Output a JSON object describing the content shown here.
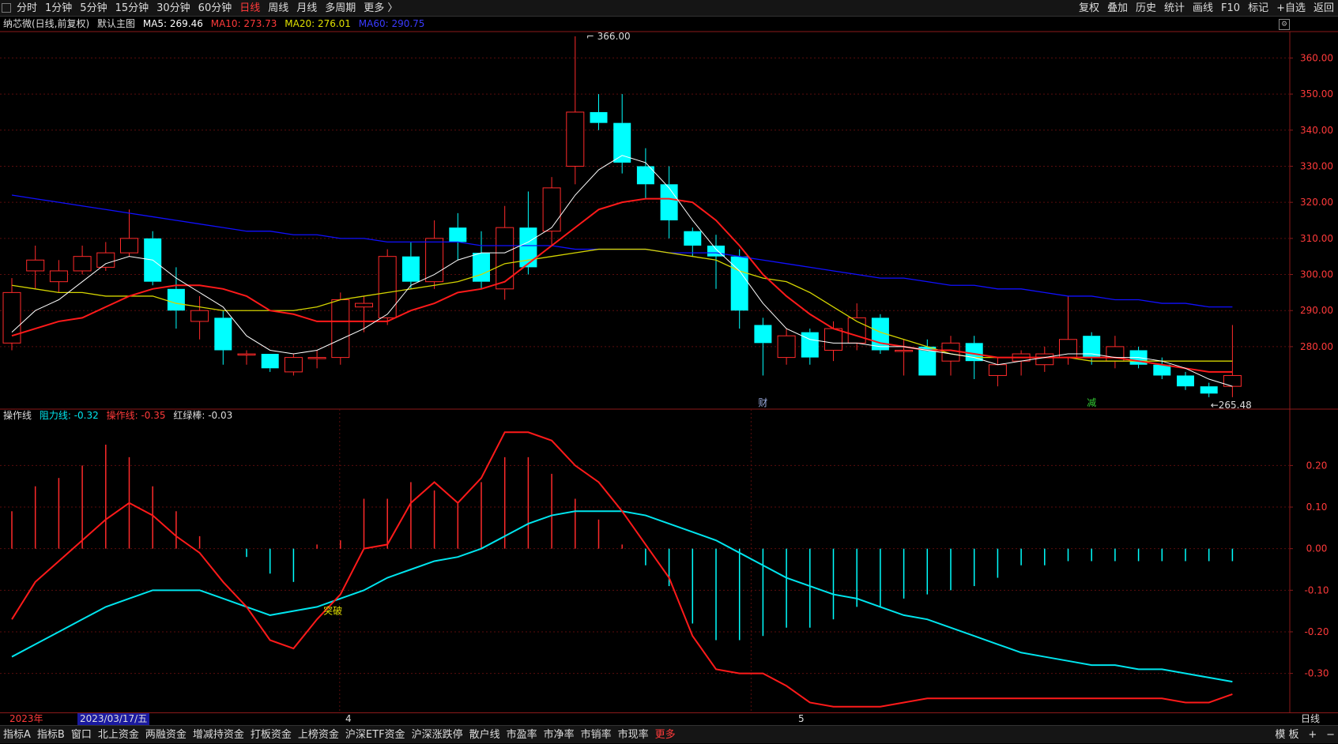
{
  "toolbar": {
    "left": [
      "分时",
      "1分钟",
      "5分钟",
      "15分钟",
      "30分钟",
      "60分钟",
      "日线",
      "周线",
      "月线",
      "多周期",
      "更多 〉"
    ],
    "active_index": 6,
    "right": [
      "复权",
      "叠加",
      "历史",
      "统计",
      "画线",
      "F10",
      "标记",
      "+自选",
      "返回"
    ]
  },
  "main_panel": {
    "title": "纳芯微(日线,前复权)",
    "template": "默认主图",
    "ma5": "MA5: 269.46",
    "ma10": "MA10: 273.73",
    "ma20": "MA20: 276.01",
    "ma60": "MA60: 290.75"
  },
  "sub_panel": {
    "title": "操作线",
    "resistance": "阻力线: -0.32",
    "operation": "操作线: -0.35",
    "bar": "红绿棒: -0.03"
  },
  "colors": {
    "up": "#ff2a2a",
    "down": "#00ffff",
    "ma5": "#ffffff",
    "ma10": "#ff1a1a",
    "ma20": "#d4d400",
    "ma60": "#1010ff",
    "resistance": "#00e5ee",
    "operation": "#ff1a1a"
  },
  "chart_data": [
    {
      "type": "candlestick",
      "name": "price",
      "ylim": [
        264,
        366
      ],
      "yticks": [
        280,
        290,
        300,
        310,
        320,
        330,
        340,
        350,
        360
      ],
      "ytick_labels": [
        "280.00",
        "290.00",
        "300.00",
        "310.00",
        "320.00",
        "330.00",
        "340.00",
        "350.00",
        "360.00"
      ],
      "annotations": {
        "high": "366.00",
        "low": "265.48",
        "events": [
          "财",
          "减"
        ]
      },
      "candles": [
        [
          281,
          295,
          279,
          299
        ],
        [
          301,
          304,
          296,
          308
        ],
        [
          298,
          301,
          295,
          304
        ],
        [
          301,
          305,
          300,
          308
        ],
        [
          302,
          306,
          301,
          309
        ],
        [
          306,
          310,
          305,
          318
        ],
        [
          310,
          298,
          297,
          312
        ],
        [
          296,
          290,
          285,
          302
        ],
        [
          287,
          290,
          282,
          294
        ],
        [
          288,
          279,
          275,
          290
        ],
        [
          278,
          278,
          275,
          279
        ],
        [
          278,
          274,
          273,
          278
        ],
        [
          273,
          277,
          272,
          278
        ],
        [
          277,
          277,
          274,
          279
        ],
        [
          277,
          293,
          275,
          295
        ],
        [
          291,
          292,
          284,
          294
        ],
        [
          288,
          305,
          286,
          307
        ],
        [
          305,
          298,
          296,
          309
        ],
        [
          298,
          310,
          296,
          315
        ],
        [
          313,
          309,
          304,
          317
        ],
        [
          306,
          298,
          296,
          312
        ],
        [
          296,
          313,
          293,
          319
        ],
        [
          313,
          302,
          300,
          323
        ],
        [
          312,
          324,
          308,
          327
        ],
        [
          330,
          345,
          325,
          366
        ],
        [
          345,
          342,
          340,
          350
        ],
        [
          342,
          331,
          328,
          350
        ],
        [
          330,
          325,
          321,
          335
        ],
        [
          325,
          315,
          310,
          330
        ],
        [
          312,
          308,
          305,
          313
        ],
        [
          308,
          305,
          296,
          311
        ],
        [
          305,
          290,
          285,
          307
        ],
        [
          286,
          281,
          272,
          288
        ],
        [
          277,
          283,
          275,
          285
        ],
        [
          284,
          277,
          275,
          285
        ],
        [
          279,
          285,
          276,
          287
        ],
        [
          281,
          288,
          279,
          292
        ],
        [
          288,
          279,
          278,
          289
        ],
        [
          279,
          279,
          272,
          282
        ],
        [
          280,
          272,
          272,
          282
        ],
        [
          276,
          281,
          272,
          283
        ],
        [
          281,
          276,
          271,
          283
        ],
        [
          272,
          275,
          269,
          277
        ],
        [
          276,
          278,
          272,
          279
        ],
        [
          275,
          278,
          273,
          280
        ],
        [
          277,
          282,
          275,
          294
        ],
        [
          283,
          277,
          275,
          284
        ],
        [
          276,
          280,
          274,
          283
        ],
        [
          279,
          275,
          274,
          280
        ],
        [
          275,
          272,
          271,
          277
        ],
        [
          272,
          269,
          268,
          273
        ],
        [
          269,
          267,
          266,
          270
        ],
        [
          269,
          272,
          266,
          286
        ]
      ],
      "ma5": [
        284,
        290,
        293,
        298,
        303,
        305,
        304,
        299,
        295,
        291,
        283,
        279,
        278,
        279,
        282,
        285,
        289,
        297,
        300,
        304,
        306,
        306,
        309,
        313,
        322,
        329,
        333,
        331,
        324,
        315,
        307,
        301,
        292,
        285,
        282,
        281,
        281,
        280,
        280,
        279,
        278,
        277,
        275,
        276,
        277,
        278,
        278,
        277,
        277,
        276,
        274,
        271,
        269
      ],
      "ma10": [
        283,
        285,
        287,
        288,
        291,
        294,
        296,
        297,
        297,
        296,
        294,
        290,
        289,
        287,
        287,
        287,
        287,
        290,
        292,
        295,
        296,
        298,
        303,
        308,
        313,
        318,
        320,
        321,
        321,
        320,
        315,
        308,
        300,
        294,
        289,
        285,
        283,
        281,
        280,
        279,
        279,
        278,
        277,
        277,
        277,
        277,
        277,
        277,
        276,
        275,
        274,
        273,
        273
      ],
      "ma20": [
        297,
        296,
        295,
        295,
        294,
        294,
        294,
        292,
        291,
        290,
        290,
        290,
        290,
        291,
        293,
        294,
        295,
        296,
        297,
        298,
        300,
        303,
        304,
        305,
        306,
        307,
        307,
        307,
        306,
        305,
        304,
        301,
        299,
        298,
        295,
        291,
        287,
        284,
        282,
        280,
        278,
        277,
        277,
        277,
        277,
        277,
        276,
        276,
        276,
        276,
        276,
        276,
        276
      ],
      "ma60": [
        322,
        321,
        320,
        319,
        318,
        317,
        316,
        315,
        314,
        313,
        312,
        312,
        311,
        311,
        310,
        310,
        309,
        309,
        309,
        309,
        308,
        308,
        308,
        308,
        307,
        307,
        307,
        307,
        306,
        306,
        306,
        305,
        304,
        303,
        302,
        301,
        300,
        299,
        299,
        298,
        297,
        297,
        296,
        296,
        295,
        294,
        294,
        293,
        293,
        292,
        292,
        291,
        291
      ]
    },
    {
      "type": "line",
      "name": "操作线",
      "ylim": [
        -0.39,
        0.29
      ],
      "yticks": [
        -0.3,
        -0.2,
        -0.1,
        0.0,
        0.1,
        0.2
      ],
      "ytick_labels": [
        "-0.30",
        "-0.20",
        "-0.10",
        "0.00",
        "0.10",
        "0.20"
      ],
      "annotation": "突破",
      "resistance": [
        -0.26,
        -0.23,
        -0.2,
        -0.17,
        -0.14,
        -0.12,
        -0.1,
        -0.1,
        -0.1,
        -0.12,
        -0.14,
        -0.16,
        -0.15,
        -0.14,
        -0.12,
        -0.1,
        -0.07,
        -0.05,
        -0.03,
        -0.02,
        0.0,
        0.03,
        0.06,
        0.08,
        0.09,
        0.09,
        0.09,
        0.08,
        0.06,
        0.04,
        0.02,
        -0.01,
        -0.04,
        -0.07,
        -0.09,
        -0.11,
        -0.12,
        -0.14,
        -0.16,
        -0.17,
        -0.19,
        -0.21,
        -0.23,
        -0.25,
        -0.26,
        -0.27,
        -0.28,
        -0.28,
        -0.29,
        -0.29,
        -0.3,
        -0.31,
        -0.32
      ],
      "operation": [
        -0.17,
        -0.08,
        -0.03,
        0.02,
        0.07,
        0.11,
        0.08,
        0.03,
        -0.01,
        -0.08,
        -0.14,
        -0.22,
        -0.24,
        -0.17,
        -0.11,
        0.0,
        0.01,
        0.11,
        0.16,
        0.11,
        0.17,
        0.28,
        0.28,
        0.26,
        0.2,
        0.16,
        0.09,
        0.01,
        -0.07,
        -0.21,
        -0.29,
        -0.3,
        -0.3,
        -0.33,
        -0.37,
        -0.38,
        -0.38,
        -0.38,
        -0.37,
        -0.36,
        -0.36,
        -0.36,
        -0.36,
        -0.36,
        -0.36,
        -0.36,
        -0.36,
        -0.36,
        -0.36,
        -0.36,
        -0.37,
        -0.37,
        -0.35
      ],
      "bars": [
        0.09,
        0.15,
        0.17,
        0.2,
        0.25,
        0.22,
        0.15,
        0.09,
        0.03,
        0.0,
        -0.02,
        -0.06,
        -0.08,
        0.01,
        0.02,
        0.12,
        0.12,
        0.16,
        0.14,
        0.11,
        0.16,
        0.22,
        0.22,
        0.18,
        0.12,
        0.07,
        0.01,
        -0.04,
        -0.09,
        -0.18,
        -0.22,
        -0.22,
        -0.21,
        -0.19,
        -0.19,
        -0.17,
        -0.14,
        -0.14,
        -0.12,
        -0.11,
        -0.1,
        -0.09,
        -0.07,
        -0.04,
        -0.04,
        -0.03,
        -0.03,
        -0.03,
        -0.03,
        -0.03,
        -0.03,
        -0.03,
        -0.03
      ]
    }
  ],
  "xaxis": {
    "labels": [
      "2023年",
      "2023/03/17/五",
      "4",
      "5"
    ],
    "period": "日线"
  },
  "bottombar": {
    "tabs": [
      "指标A",
      "指标B",
      "窗口",
      "北上资金",
      "两融资金",
      "增减持资金",
      "打板资金",
      "上榜资金",
      "沪深ETF资金",
      "沪深涨跌停",
      "散户线",
      "市盈率",
      "市净率",
      "市销率",
      "市现率",
      "更多"
    ],
    "right": [
      "模 板",
      "+",
      "−"
    ]
  }
}
